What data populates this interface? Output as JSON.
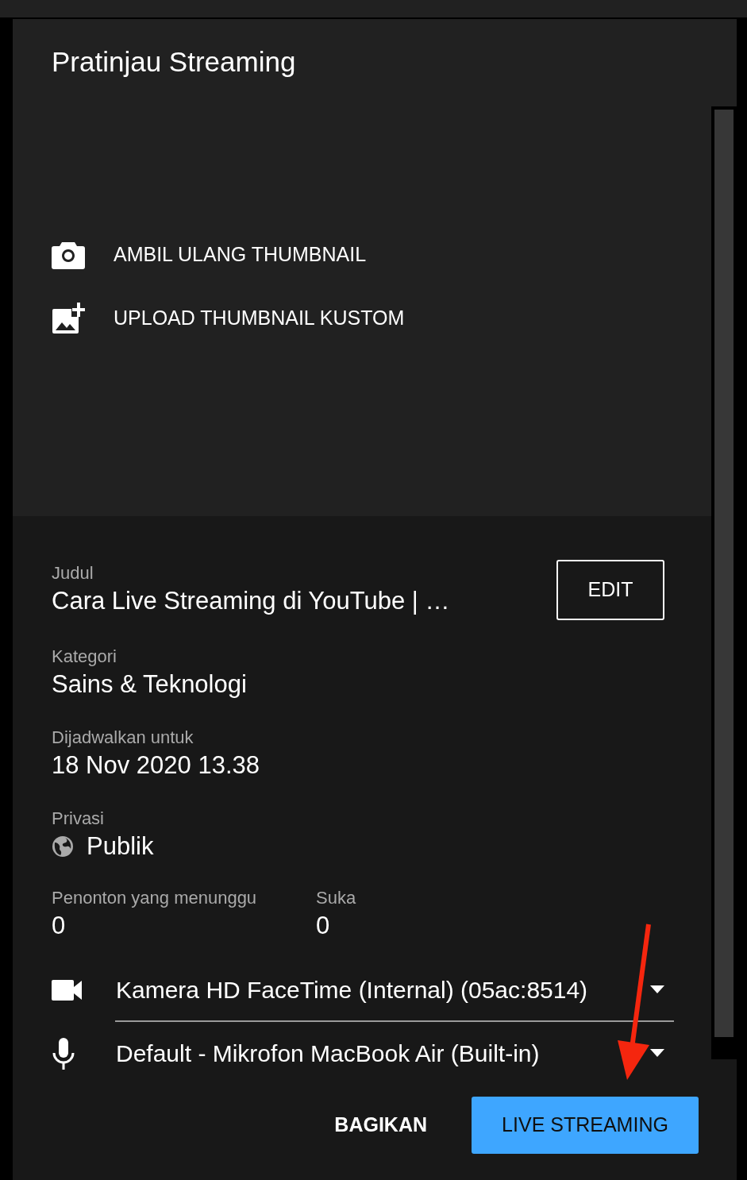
{
  "dialog": {
    "title": "Pratinjau Streaming"
  },
  "thumbnail_actions": [
    {
      "kind": "camera",
      "label": "AMBIL ULANG THUMBNAIL"
    },
    {
      "kind": "upload",
      "label": "UPLOAD THUMBNAIL KUSTOM"
    }
  ],
  "details": {
    "title": {
      "label": "Judul",
      "value": "Cara Live Streaming di YouTube | …"
    },
    "edit_button": "EDIT",
    "category": {
      "label": "Kategori",
      "value": "Sains & Teknologi"
    },
    "scheduled": {
      "label": "Dijadwalkan untuk",
      "value": "18 Nov 2020 13.38"
    },
    "privacy": {
      "label": "Privasi",
      "value": "Publik"
    },
    "stats": [
      {
        "label": "Penonton yang menunggu",
        "value": "0"
      },
      {
        "label": "Suka",
        "value": "0"
      }
    ]
  },
  "devices": [
    {
      "kind": "camera",
      "value": "Kamera HD FaceTime (Internal) (05ac:8514)",
      "focused": true
    },
    {
      "kind": "microphone",
      "value": "Default - Mikrofon MacBook Air (Built-in)",
      "focused": false
    }
  ],
  "buttons": [
    {
      "label": "BAGIKAN",
      "primary": false
    },
    {
      "label": "LIVE STREAMING",
      "primary": true
    }
  ]
}
